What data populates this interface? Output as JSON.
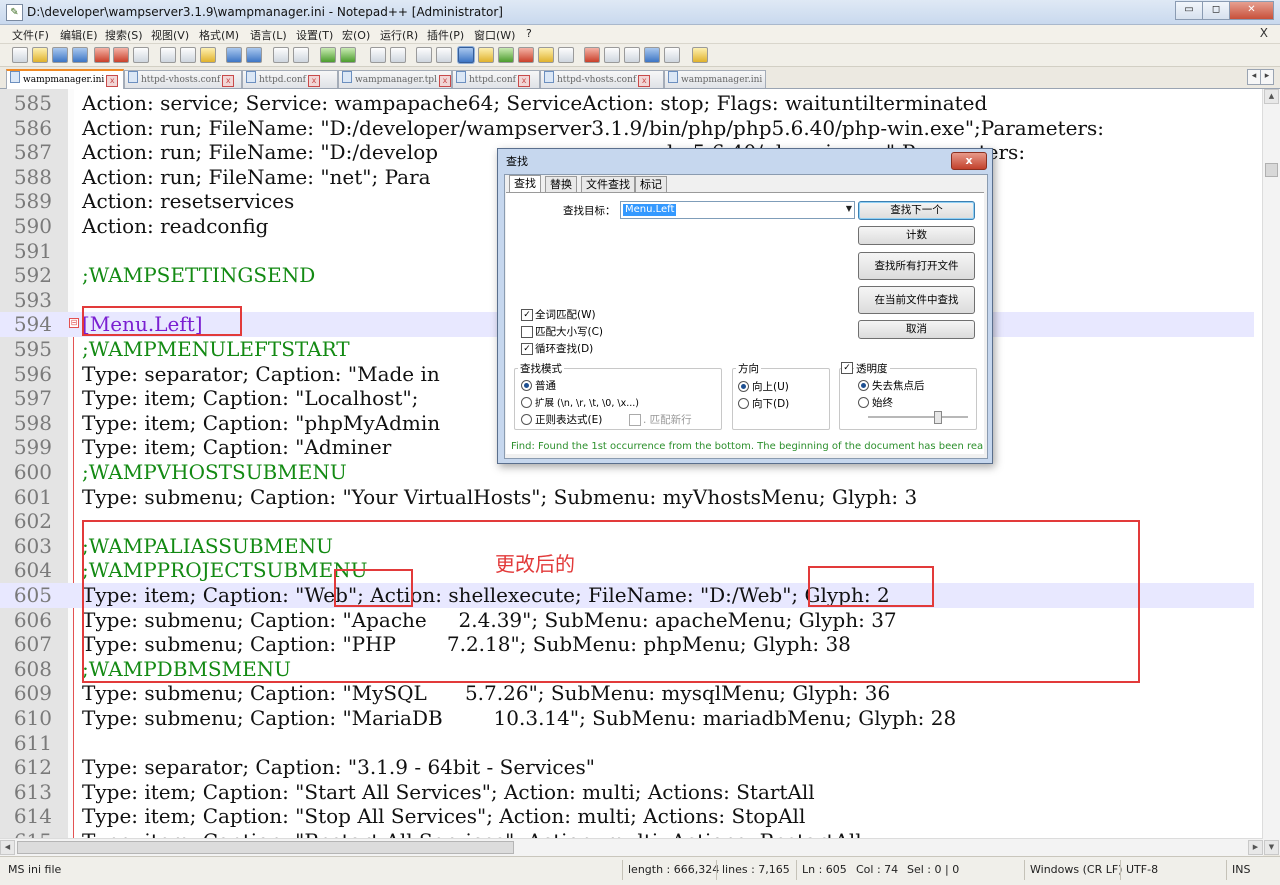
{
  "window": {
    "title": "D:\\developer\\wampserver3.1.9\\wampmanager.ini - Notepad++ [Administrator]",
    "min_glyph": "▭",
    "max_glyph": "◻",
    "close_glyph": "✕"
  },
  "menu": {
    "items": [
      "文件(F)",
      "编辑(E)",
      "搜索(S)",
      "视图(V)",
      "格式(M)",
      "语言(L)",
      "设置(T)",
      "宏(O)",
      "运行(R)",
      "插件(P)",
      "窗口(W)",
      "?"
    ],
    "close": "X"
  },
  "tabs": [
    {
      "label": "wampmanager.ini",
      "active": true
    },
    {
      "label": "httpd-vhosts.conf",
      "active": false
    },
    {
      "label": "httpd.conf",
      "active": false
    },
    {
      "label": "wampmanager.tpl",
      "active": false
    },
    {
      "label": "httpd.conf",
      "active": false
    },
    {
      "label": "httpd-vhosts.conf",
      "active": false
    },
    {
      "label": "wampmanager.ini",
      "active": false
    }
  ],
  "tab_close": "x",
  "tab_nav": {
    "left": "◂",
    "right": "▸"
  },
  "editor": {
    "lines": [
      {
        "num": "585",
        "text": "Action: service; Service: wampapache64; ServiceAction: stop; Flags: waituntilterminated",
        "style": "def"
      },
      {
        "num": "586",
        "text": "Action: run; FileName: \"D:/developer/wampserver3.1.9/bin/php/php5.6.40/php-win.exe\";Parameters: ",
        "style": "def"
      },
      {
        "num": "587",
        "text": "Action: run; FileName: \"D:/develop                                    hp5.6.40/php-win.exe\";Parameters: ",
        "style": "def"
      },
      {
        "num": "588",
        "text": "Action: run; FileName: \"net\"; Para                                         idden; Flags: waitunt",
        "style": "def"
      },
      {
        "num": "589",
        "text": "Action: resetservices",
        "style": "def"
      },
      {
        "num": "590",
        "text": "Action: readconfig",
        "style": "def"
      },
      {
        "num": "591",
        "text": "",
        "style": "def"
      },
      {
        "num": "592",
        "text": ";WAMPSETTINGSEND",
        "style": "com"
      },
      {
        "num": "593",
        "text": "",
        "style": "def"
      },
      {
        "num": "594",
        "text": "[Menu.Left]",
        "style": "sec",
        "fold": "⊟",
        "highlight": true
      },
      {
        "num": "595",
        "text": ";WAMPMENULEFTSTART",
        "style": "com"
      },
      {
        "num": "596",
        "text": "Type: separator; Caption: \"Made in",
        "style": "def"
      },
      {
        "num": "597",
        "text": "Type: item; Caption: \"Localhost\";                                               (x86)/Internet Explor",
        "style": "def"
      },
      {
        "num": "598",
        "text": "Type: item; Caption: \"phpMyAdmin                                                gram Files (x86)/Inter",
        "style": "def"
      },
      {
        "num": "599",
        "text": "Type: item; Caption: \"Adminer                                                   gram Files (x86)/Inter",
        "style": "def"
      },
      {
        "num": "600",
        "text": ";WAMPVHOSTSUBMENU",
        "style": "com"
      },
      {
        "num": "601",
        "text": "Type: submenu; Caption: \"Your VirtualHosts\"; Submenu: myVhostsMenu; Glyph: 3",
        "style": "def"
      },
      {
        "num": "602",
        "text": "",
        "style": "def"
      },
      {
        "num": "603",
        "text": ";WAMPALIASSUBMENU",
        "style": "com"
      },
      {
        "num": "604",
        "text": ";WAMPPROJECTSUBMENU",
        "style": "com"
      },
      {
        "num": "605",
        "text": "Type: item; Caption: \"Web\"; Action: shellexecute; FileName: \"D:/Web\"; Glyph: 2",
        "style": "def",
        "highlight": true
      },
      {
        "num": "606",
        "text": "Type: submenu; Caption: \"Apache     2.4.39\"; SubMenu: apacheMenu; Glyph: 37",
        "style": "def"
      },
      {
        "num": "607",
        "text": "Type: submenu; Caption: \"PHP        7.2.18\"; SubMenu: phpMenu; Glyph: 38",
        "style": "def"
      },
      {
        "num": "608",
        "text": ";WAMPDBMSMENU",
        "style": "com"
      },
      {
        "num": "609",
        "text": "Type: submenu; Caption: \"MySQL      5.7.26\"; SubMenu: mysqlMenu; Glyph: 36",
        "style": "def"
      },
      {
        "num": "610",
        "text": "Type: submenu; Caption: \"MariaDB        10.3.14\"; SubMenu: mariadbMenu; Glyph: 28",
        "style": "def"
      },
      {
        "num": "611",
        "text": "",
        "style": "def"
      },
      {
        "num": "612",
        "text": "Type: separator; Caption: \"3.1.9 - 64bit - Services\"",
        "style": "def"
      },
      {
        "num": "613",
        "text": "Type: item; Caption: \"Start All Services\"; Action: multi; Actions: StartAll",
        "style": "def"
      },
      {
        "num": "614",
        "text": "Type: item; Caption: \"Stop All Services\"; Action: multi; Actions: StopAll",
        "style": "def"
      },
      {
        "num": "615",
        "text": "Type: item; Caption: \"Restart All Services\"; Action: multi; Actions: RestartAll",
        "style": "def"
      }
    ]
  },
  "annotation": {
    "label": "更改后的",
    "color": "#e23a3a"
  },
  "status": {
    "file_type": "MS ini file",
    "length": "length : 666,324",
    "lines": "lines : 7,165",
    "ln": "Ln : 605",
    "col": "Col : 74",
    "sel": "Sel : 0 | 0",
    "eol": "Windows (CR LF)",
    "encoding": "UTF-8",
    "mode": "INS"
  },
  "find_dialog": {
    "title": "查找",
    "close": "x",
    "tabs": [
      "查找",
      "替换",
      "文件查找",
      "标记"
    ],
    "target_label": "查找目标：",
    "target_value": "Menu.Left",
    "buttons": [
      "查找下一个",
      "计数",
      "查找所有打开文件",
      "在当前文件中查找",
      "取消"
    ],
    "checks": [
      {
        "label": "全词匹配(W)",
        "checked": true
      },
      {
        "label": "匹配大小写(C)",
        "checked": false
      },
      {
        "label": "循环查找(D)",
        "checked": true
      }
    ],
    "mode_title": "查找模式",
    "modes": [
      {
        "label": "普通",
        "on": true
      },
      {
        "label": "扩展 (\\n, \\r, \\t, \\0, \\x...)",
        "on": false
      },
      {
        "label": "正则表达式(E)",
        "on": false
      }
    ],
    "dot_newline": ". 匹配新行",
    "direction_title": "方向",
    "directions": [
      {
        "label": "向上(U)",
        "on": true
      },
      {
        "label": "向下(D)",
        "on": false
      }
    ],
    "transparency_label": "透明度",
    "transparency_checked": true,
    "transparency_opts": [
      {
        "label": "失去焦点后",
        "on": true
      },
      {
        "label": "始终",
        "on": false
      }
    ],
    "transparency_level": 0.7,
    "status": "Find: Found the 1st occurrence from the bottom. The beginning of the document has been rea"
  },
  "colors": {
    "accent": "#f08a24",
    "comment": "#138a13",
    "section": "#7a1fd1",
    "annotation": "#e23a3a"
  }
}
